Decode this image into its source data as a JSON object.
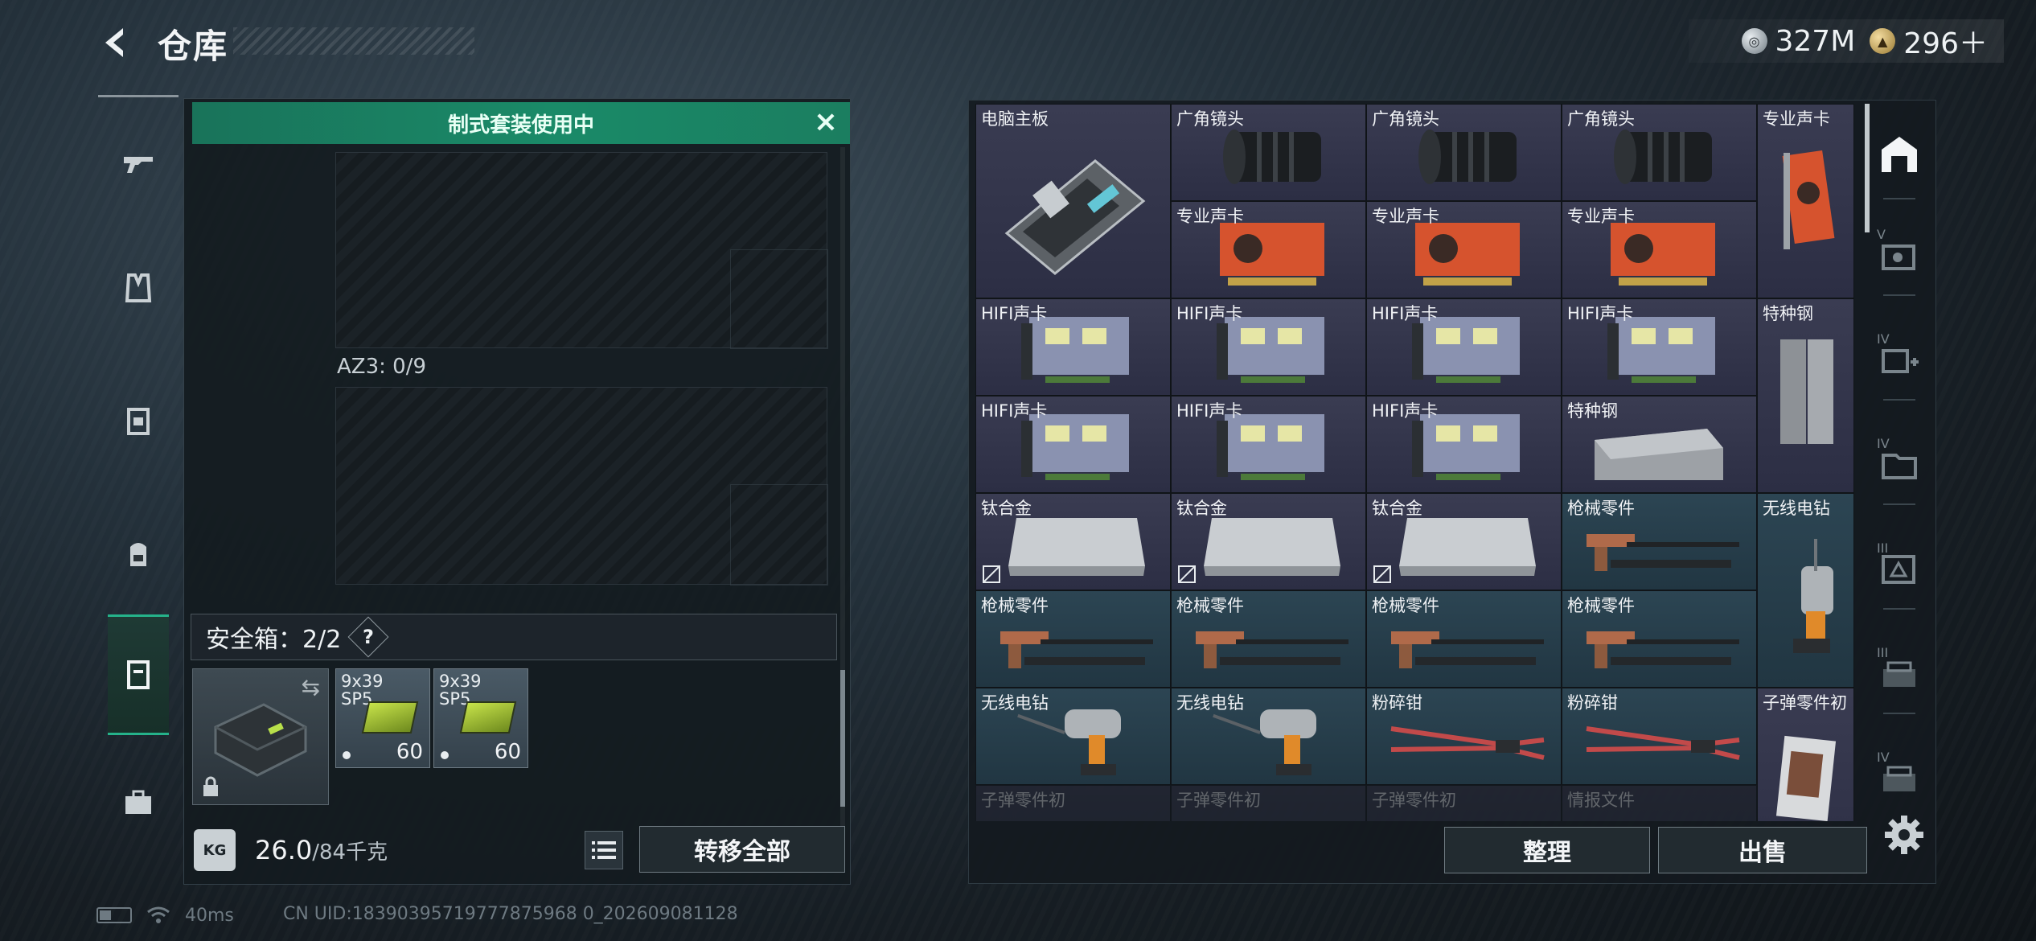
{
  "header": {
    "title": "仓库",
    "currencies": [
      {
        "icon": "silver-coin-icon",
        "value": "327M"
      },
      {
        "icon": "gold-coin-icon",
        "value": "296＋"
      }
    ]
  },
  "left_rail": [
    "gun-icon",
    "armor-vest-icon",
    "chest-rig-icon",
    "backpack-icon",
    "safebox-icon",
    "toolbox-icon"
  ],
  "loadout": {
    "banner": "制式套装使用中",
    "az_label": "AZ3: 0/9",
    "safebox_label": "安全箱：2/2",
    "help_label": "?",
    "ammo": [
      {
        "name": "9x39\nSP5",
        "count": "60"
      },
      {
        "name": "9x39\nSP5",
        "count": "60"
      }
    ],
    "weight_value": "26.0",
    "weight_capacity": "/84千克",
    "kg_badge": "KG",
    "transfer_all": "转移全部"
  },
  "stash": {
    "items": [
      {
        "name": "电脑主板"
      },
      {
        "name": "广角镜头"
      },
      {
        "name": "广角镜头"
      },
      {
        "name": "广角镜头"
      },
      {
        "name": "专业声卡"
      },
      {
        "name": "专业声卡"
      },
      {
        "name": "专业声卡"
      },
      {
        "name": "专业声卡"
      },
      {
        "name": "HIFI声卡"
      },
      {
        "name": "HIFI声卡"
      },
      {
        "name": "HIFI声卡"
      },
      {
        "name": "HIFI声卡"
      },
      {
        "name": "特种钢"
      },
      {
        "name": "HIFI声卡"
      },
      {
        "name": "HIFI声卡"
      },
      {
        "name": "HIFI声卡"
      },
      {
        "name": "特种钢"
      },
      {
        "name": "钛合金"
      },
      {
        "name": "钛合金"
      },
      {
        "name": "钛合金"
      },
      {
        "name": "枪械零件"
      },
      {
        "name": "无线电钻"
      },
      {
        "name": "枪械零件"
      },
      {
        "name": "枪械零件"
      },
      {
        "name": "枪械零件"
      },
      {
        "name": "枪械零件"
      },
      {
        "name": "无线电钻"
      },
      {
        "name": "无线电钻"
      },
      {
        "name": "粉碎钳"
      },
      {
        "name": "粉碎钳"
      },
      {
        "name": "子弹零件初"
      },
      {
        "name": "子弹零件初"
      },
      {
        "name": "子弹零件初"
      },
      {
        "name": "子弹零件初"
      },
      {
        "name": "情报文件"
      }
    ],
    "sort_button": "整理",
    "sell_button": "出售"
  },
  "right_rail": [
    {
      "icon": "stash-icon",
      "label": ""
    },
    {
      "icon": "gear-box-icon",
      "label": "V"
    },
    {
      "icon": "medical-plus-icon",
      "label": "IV"
    },
    {
      "icon": "folder-icon",
      "label": "IV"
    },
    {
      "icon": "triangle-box-icon",
      "label": "III"
    },
    {
      "icon": "crate-icon",
      "label": "III"
    },
    {
      "icon": "crate-icon",
      "label": "IV"
    }
  ],
  "status": {
    "ping": "40ms",
    "uid": "CN UID:18390395719777875968 0_202609081128"
  }
}
